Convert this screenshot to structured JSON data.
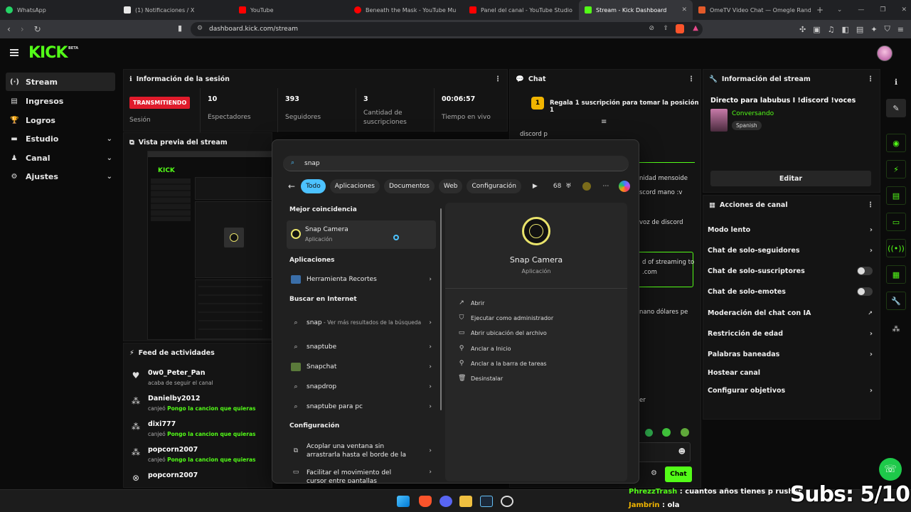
{
  "browser": {
    "tabs": [
      {
        "label": "WhatsApp",
        "color": "#25d366"
      },
      {
        "label": "(1) Notificaciones / X",
        "color": "#e7e7e7"
      },
      {
        "label": "YouTube",
        "color": "#ff0000"
      },
      {
        "label": "Beneath the Mask - YouTube Mu",
        "color": "#ff0000"
      },
      {
        "label": "Panel del canal - YouTube Studio",
        "color": "#ff0000"
      },
      {
        "label": "Stream - Kick Dashboard",
        "color": "#53fc18"
      },
      {
        "label": "OmeTV Video Chat — Omegle Rand",
        "color": "#e35a2a"
      }
    ],
    "url": "dashboard.kick.com/stream"
  },
  "kick": {
    "logo": "KICK",
    "beta": "BETA",
    "accent": "#53fc18"
  },
  "sidebar": {
    "items": [
      {
        "label": "Stream",
        "icon": "stream-icon"
      },
      {
        "label": "Ingresos",
        "icon": "income-icon"
      },
      {
        "label": "Logros",
        "icon": "trophy-icon"
      },
      {
        "label": "Estudio",
        "icon": "studio-icon"
      },
      {
        "label": "Canal",
        "icon": "channel-icon"
      },
      {
        "label": "Ajustes",
        "icon": "gear-icon"
      }
    ]
  },
  "session": {
    "title": "Información de la sesión",
    "badge": "TRANSMITIENDO",
    "badge_label": "Sesión",
    "stats": [
      {
        "value": "10",
        "label": "Espectadores"
      },
      {
        "value": "393",
        "label": "Seguidores"
      },
      {
        "value": "3",
        "label": "Cantidad de suscripciones"
      },
      {
        "value": "00:06:57",
        "label": "Tiempo en vivo"
      }
    ]
  },
  "preview": {
    "title": "Vista previa del stream"
  },
  "feed": {
    "title": "Feed de actividades",
    "items": [
      {
        "name": "0w0_Peter_Pan",
        "text": "acaba de seguir el canal",
        "reward": ""
      },
      {
        "name": "Danielby2012",
        "text": "canjeó ",
        "reward": "Pongo la cancion que quieras"
      },
      {
        "name": "dixi777",
        "text": "canjeó ",
        "reward": "Pongo la cancion que quieras"
      },
      {
        "name": "popcorn2007",
        "text": "canjeó ",
        "reward": "Pongo la cancion que quieras"
      },
      {
        "name": "popcorn2007",
        "text": "",
        "reward": ""
      }
    ]
  },
  "chat": {
    "title": "Chat",
    "pinned": "Regala 1 suscripción para tomar la posición 1",
    "messages": [
      "discord p",
      "nidad mensoide",
      "scord mano :v",
      "voz de discord",
      "d of streaming to",
      ".com",
      "nano dólares pe",
      "er"
    ],
    "send_label": "Chat"
  },
  "stream_info": {
    "title": "Información del stream",
    "stream_title": "Directo para labubus I !discord !voces",
    "category": "Conversando",
    "language": "Spanish",
    "edit_label": "Editar"
  },
  "channel_actions": {
    "title": "Acciones de canal",
    "items": [
      {
        "label": "Modo lento",
        "kind": "chevron"
      },
      {
        "label": "Chat de solo-seguidores",
        "kind": "chevron"
      },
      {
        "label": "Chat de solo-suscriptores",
        "kind": "toggle"
      },
      {
        "label": "Chat de solo-emotes",
        "kind": "toggle"
      },
      {
        "label": "Moderación del chat con IA",
        "kind": "external"
      },
      {
        "label": "Restricción de edad",
        "kind": "chevron"
      },
      {
        "label": "Palabras baneadas",
        "kind": "chevron"
      },
      {
        "label": "Hostear canal",
        "kind": "none"
      },
      {
        "label": "Configurar objetivos",
        "kind": "chevron"
      }
    ]
  },
  "win_search": {
    "query": "snap",
    "filters": [
      "Todo",
      "Aplicaciones",
      "Documentos",
      "Web",
      "Configuración"
    ],
    "points": "68",
    "best_match_label": "Mejor coincidencia",
    "best_match": {
      "name": "Snap Camera",
      "type": "Aplicación"
    },
    "apps_label": "Aplicaciones",
    "apps": [
      "Herramienta Recortes"
    ],
    "web_label": "Buscar en Internet",
    "web": [
      {
        "label": "snap",
        "sub": " - Ver más resultados de la búsqueda"
      },
      {
        "label": "snaptube",
        "sub": ""
      },
      {
        "label": "Snapchat",
        "sub": ""
      },
      {
        "label": "snapdrop",
        "sub": ""
      },
      {
        "label": "snaptube para pc",
        "sub": ""
      }
    ],
    "settings_label": "Configuración",
    "settings": [
      "Acoplar una ventana sin arrastrarla hasta el borde de la",
      "Facilitar el movimiento del cursor entre pantallas"
    ],
    "actions": [
      "Abrir",
      "Ejecutar como administrador",
      "Abrir ubicación del archivo",
      "Anclar a Inicio",
      "Anclar a la barra de tareas",
      "Desinstalar"
    ]
  },
  "overlay": {
    "chat": [
      {
        "user": "PhrezzTrash",
        "msg": " : cuantos años tienes p rusher",
        "color": "#53fc18"
      },
      {
        "user": "Jambrin",
        "msg": " : ola",
        "color": "#f0b400"
      }
    ],
    "subs": "Subs: 5/10"
  }
}
